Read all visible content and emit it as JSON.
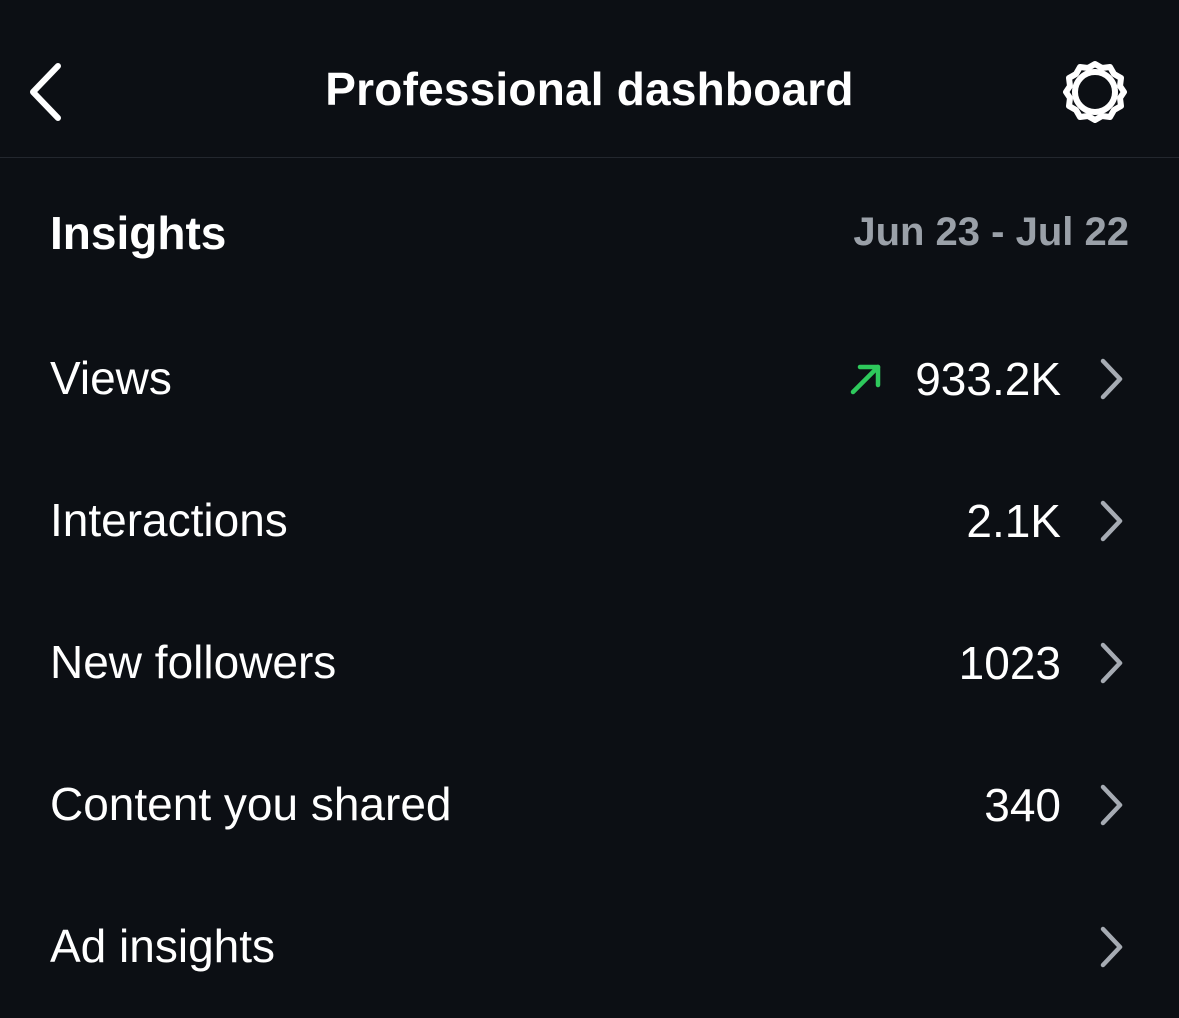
{
  "header": {
    "title": "Professional dashboard",
    "back_icon": "chevron-left-icon",
    "settings_icon": "gear-icon"
  },
  "insights": {
    "title": "Insights",
    "date_range": "Jun 23 - Jul 22"
  },
  "rows": [
    {
      "label": "Views",
      "value": "933.2K",
      "trend": "up",
      "trend_color": "#2ec95c"
    },
    {
      "label": "Interactions",
      "value": "2.1K"
    },
    {
      "label": "New followers",
      "value": "1023"
    },
    {
      "label": "Content you shared",
      "value": "340"
    },
    {
      "label": "Ad insights",
      "value": ""
    }
  ],
  "colors": {
    "background": "#0c0f14",
    "text": "#ffffff",
    "muted": "#9aa0a8",
    "chevron": "#a6abb3",
    "trend_up": "#2ec95c"
  }
}
